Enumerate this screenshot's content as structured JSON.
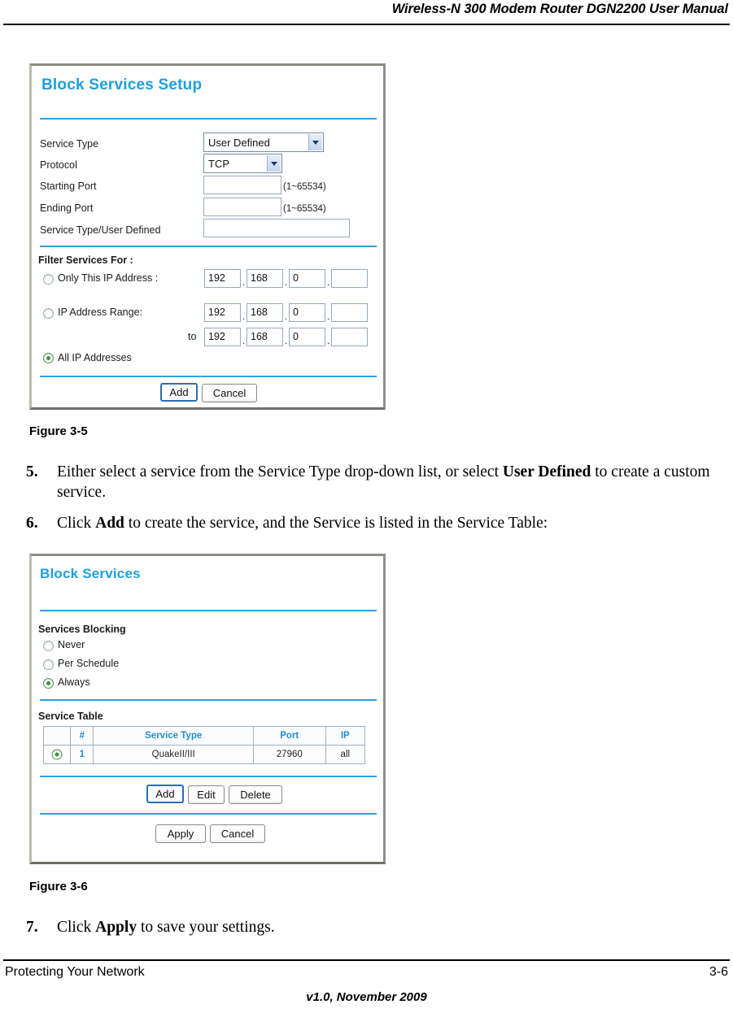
{
  "header": {
    "title": "Wireless-N 300 Modem Router DGN2200 User Manual"
  },
  "figure1": {
    "caption": "Figure 3-5",
    "screen": {
      "title": "Block Services Setup",
      "fields": {
        "service_type_label": "Service Type",
        "service_type_value": "User Defined",
        "protocol_label": "Protocol",
        "protocol_value": "TCP",
        "starting_port_label": "Starting Port",
        "starting_port_value": "",
        "starting_port_hint": "(1~65534)",
        "ending_port_label": "Ending Port",
        "ending_port_value": "",
        "ending_port_hint": "(1~65534)",
        "user_defined_label": "Service Type/User Defined",
        "user_defined_value": ""
      },
      "filter": {
        "heading": "Filter Services For :",
        "only_this_ip_label": "Only This IP Address :",
        "only_this_ip_selected": false,
        "only_this_ip_octets": [
          "192",
          "168",
          "0",
          ""
        ],
        "ip_range_label": "IP Address Range:",
        "ip_range_selected": false,
        "ip_range_from_octets": [
          "192",
          "168",
          "0",
          ""
        ],
        "ip_range_to_label": "to",
        "ip_range_to_octets": [
          "192",
          "168",
          "0",
          ""
        ],
        "all_ip_label": "All IP Addresses",
        "all_ip_selected": true,
        "dot": "."
      },
      "buttons": {
        "add": "Add",
        "cancel": "Cancel"
      }
    }
  },
  "steps": [
    {
      "number": "5.",
      "text_before": "Either select a service from the Service Type drop-down list, or select ",
      "bold": "User Defined",
      "text_after": " to create a custom service."
    },
    {
      "number": "6.",
      "text_before": "Click ",
      "bold": "Add",
      "text_after": " to create the service, and the Service is listed in the Service Table:"
    },
    {
      "number": "7.",
      "text_before": "Click ",
      "bold": "Apply",
      "text_after": " to save your settings."
    }
  ],
  "figure2": {
    "caption": "Figure 3-6",
    "screen": {
      "title": "Block Services",
      "services_blocking": {
        "heading": "Services Blocking",
        "options": [
          {
            "label": "Never",
            "selected": false
          },
          {
            "label": "Per Schedule",
            "selected": false
          },
          {
            "label": "Always",
            "selected": true
          }
        ]
      },
      "service_table": {
        "heading": "Service Table",
        "columns": [
          "",
          "#",
          "Service Type",
          "Port",
          "IP"
        ],
        "rows": [
          {
            "selected": true,
            "index": "1",
            "service_type": "QuakeII/III",
            "port": "27960",
            "ip": "all"
          }
        ]
      },
      "row_buttons": [
        "Add",
        "Edit",
        "Delete"
      ],
      "form_buttons": [
        "Apply",
        "Cancel"
      ]
    }
  },
  "footer": {
    "left": "Protecting Your Network",
    "right": "3-6",
    "center": "v1.0, November 2009"
  },
  "colors": {
    "accent_blue": "#1f9fdc",
    "rule_blue": "#2aa3e0",
    "radio_green": "#2e9b2e"
  }
}
